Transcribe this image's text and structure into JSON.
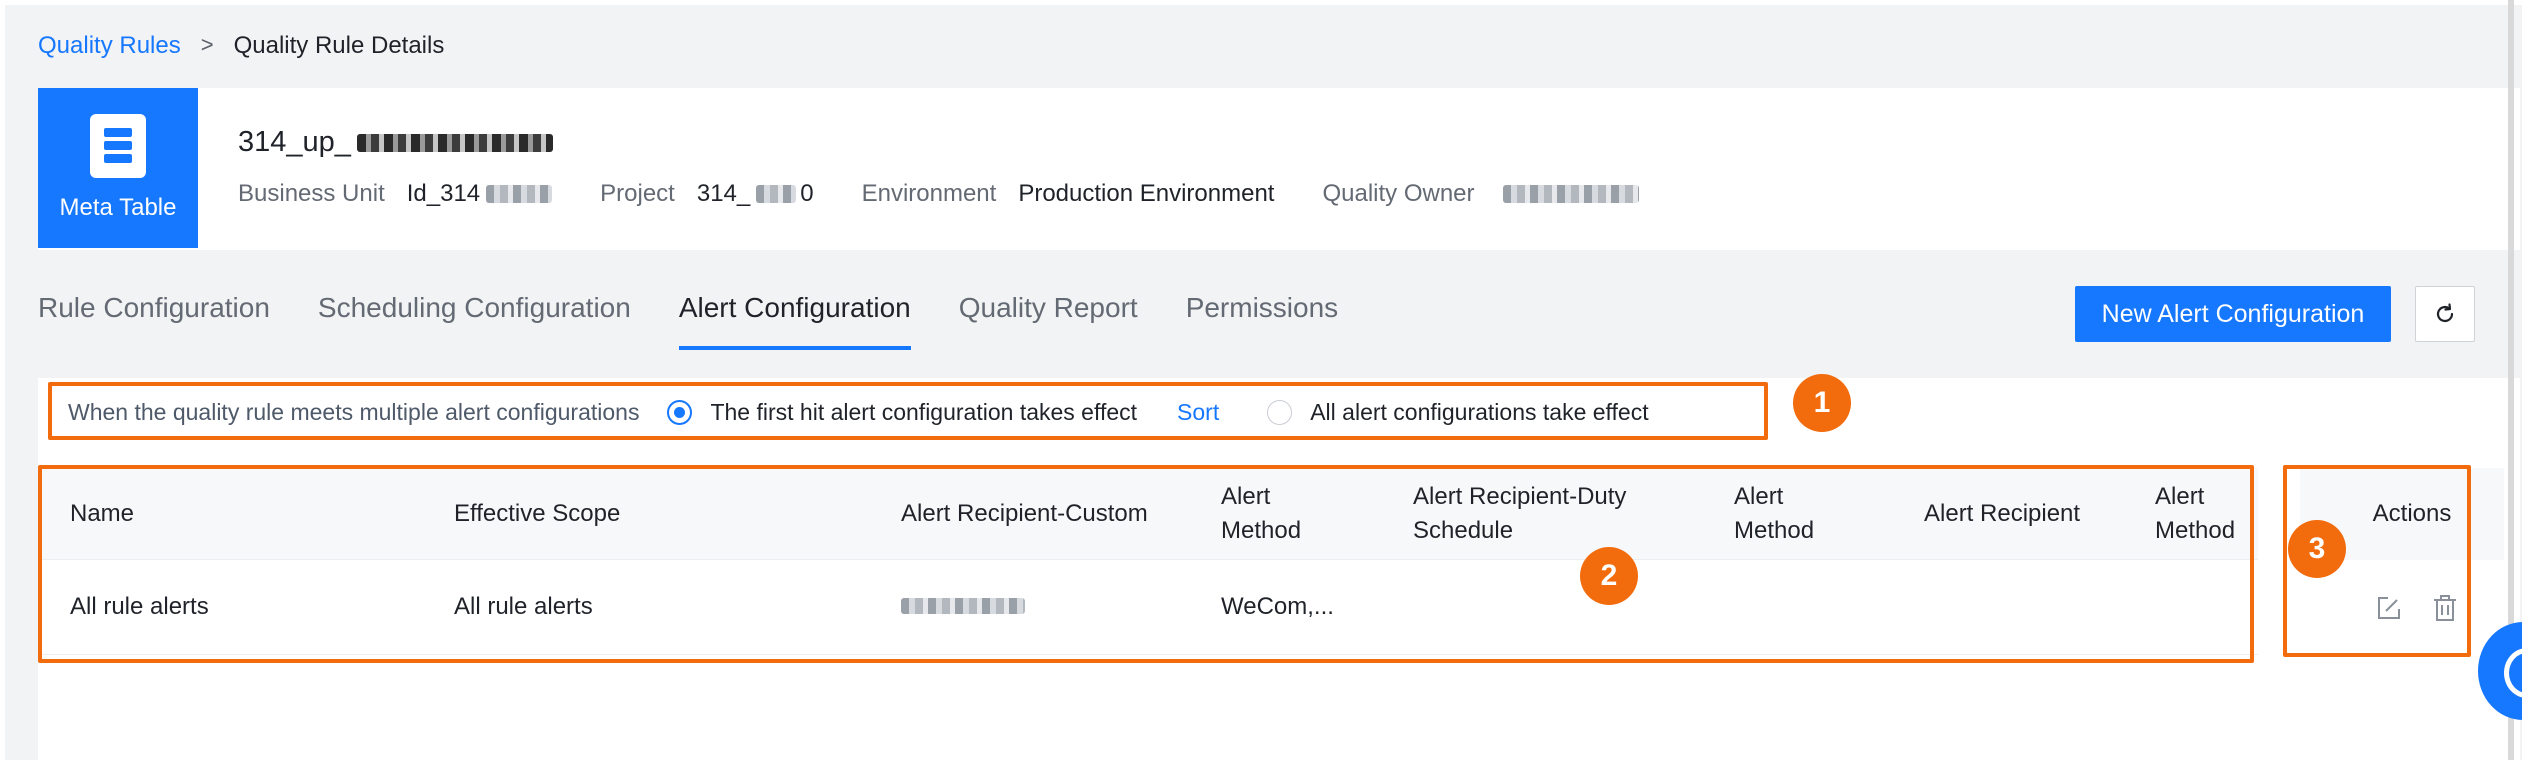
{
  "breadcrumb": {
    "parent": "Quality Rules",
    "separator": ">",
    "current": "Quality Rule Details"
  },
  "header": {
    "badge_label": "Meta Table",
    "badge_icon": "database-table-icon",
    "table_name_prefix": "314_up_",
    "fields": [
      {
        "key": "Business Unit",
        "value_prefix": "Id_314"
      },
      {
        "key": "Project",
        "value_prefix": "314_",
        "value_suffix": "0"
      },
      {
        "key": "Environment",
        "value": "Production Environment"
      },
      {
        "key": "Quality Owner"
      }
    ]
  },
  "tabs": [
    {
      "label": "Rule Configuration",
      "active": false
    },
    {
      "label": "Scheduling Configuration",
      "active": false
    },
    {
      "label": "Alert Configuration",
      "active": true
    },
    {
      "label": "Quality Report",
      "active": false
    },
    {
      "label": "Permissions",
      "active": false
    }
  ],
  "toolbar": {
    "new_button": "New Alert Configuration",
    "refresh_icon": "refresh-icon"
  },
  "mode": {
    "question": "When the quality rule meets multiple alert configurations",
    "option_first": "The first hit alert configuration takes effect",
    "option_first_selected": true,
    "sort_link": "Sort",
    "option_all": "All alert configurations take effect"
  },
  "table": {
    "columns": [
      "Name",
      "Effective Scope",
      "Alert Recipient-Custom",
      "Alert Method",
      "Alert Recipient-Duty Schedule",
      "Alert Method",
      "Alert Recipient",
      "Alert Method"
    ],
    "rows": [
      {
        "name": "All rule alerts",
        "scope": "All rule alerts",
        "method": "WeCom,..."
      }
    ],
    "actions_header": "Actions",
    "edit_icon": "edit-icon",
    "delete_icon": "trash-icon"
  },
  "annotations": [
    "1",
    "2",
    "3"
  ],
  "colors": {
    "primary": "#1677ff",
    "annotation": "#f26c0d"
  }
}
